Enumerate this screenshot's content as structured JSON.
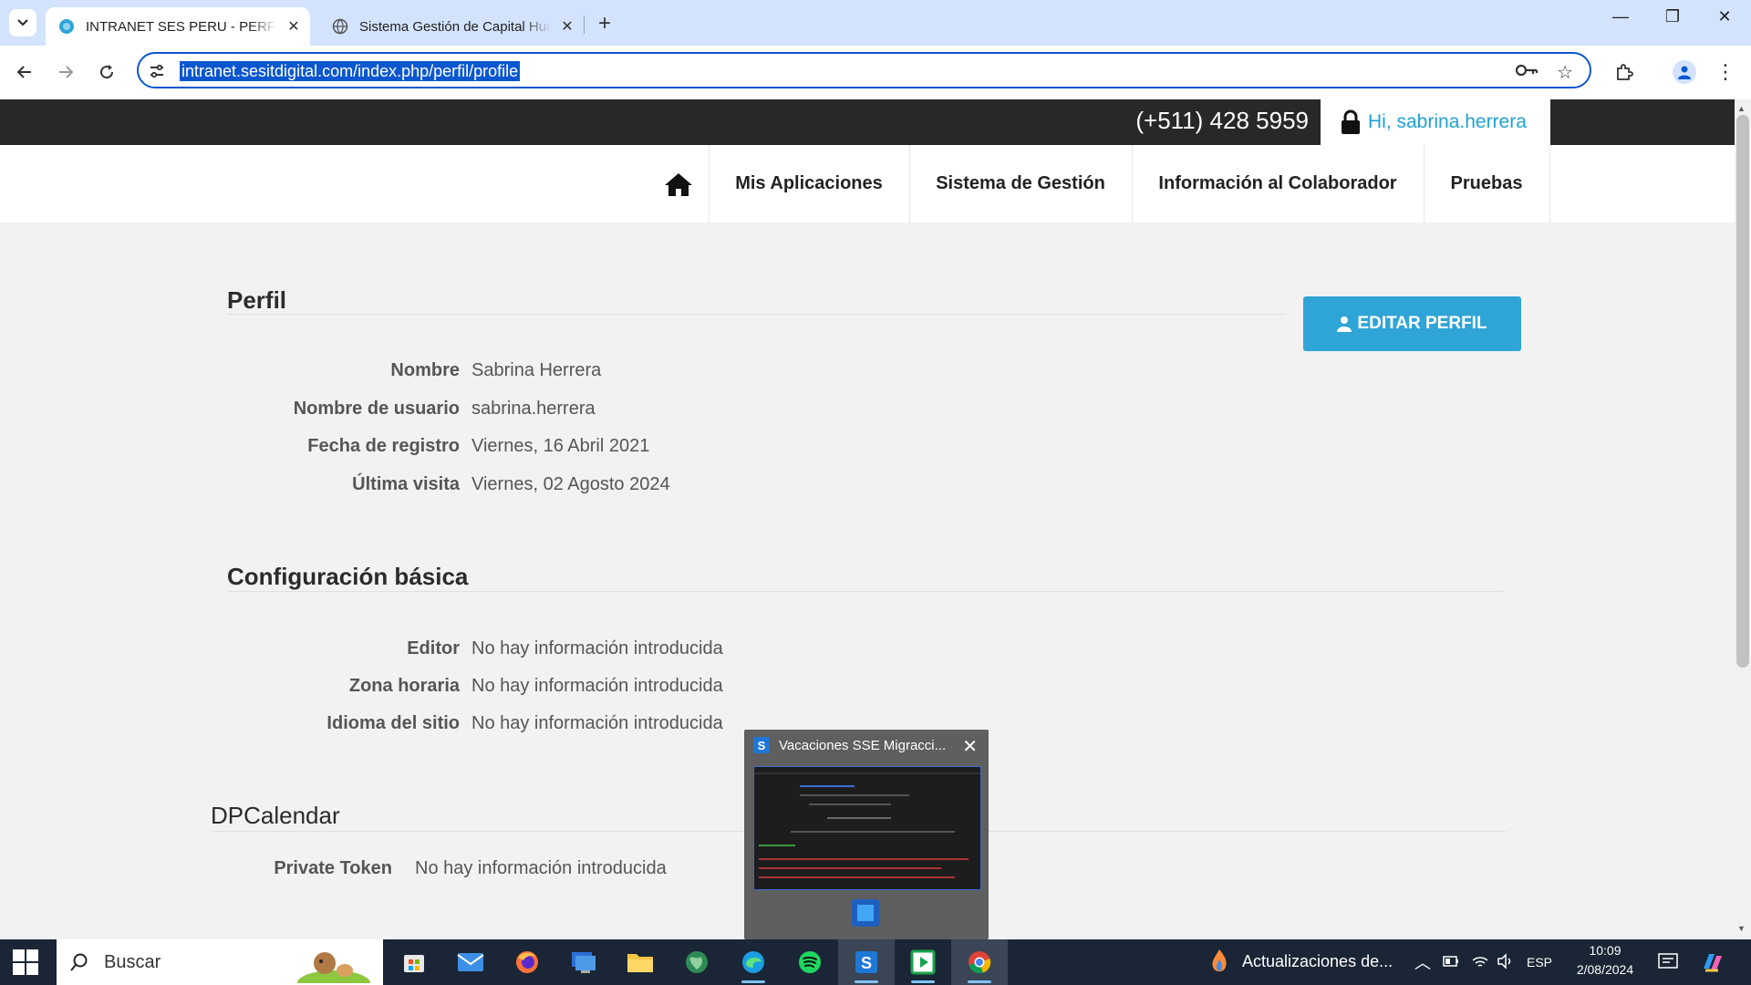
{
  "browser": {
    "tabs": [
      {
        "title": "INTRANET SES PERU - PERFIL D",
        "active": true
      },
      {
        "title": "Sistema Gestión de Capital Hum",
        "active": false
      }
    ],
    "url": "intranet.sesitdigital.com/index.php/perfil/profile",
    "accent": "#0b57d0"
  },
  "site": {
    "phone": "(+511) 428 5959",
    "greeting": "Hi, sabrina.herrera",
    "nav": [
      "Mis Aplicaciones",
      "Sistema de Gestión",
      "Información al Colaborador",
      "Pruebas"
    ],
    "brand_color": "#2fa4d6"
  },
  "profile": {
    "title": "Perfil",
    "edit_button": "EDITAR PERFIL",
    "rows": [
      {
        "label": "Nombre",
        "value": "Sabrina Herrera"
      },
      {
        "label": "Nombre de usuario",
        "value": "sabrina.herrera"
      },
      {
        "label": "Fecha de registro",
        "value": "Viernes, 16 Abril 2021"
      },
      {
        "label": "Última visita",
        "value": "Viernes, 02 Agosto 2024"
      }
    ]
  },
  "config": {
    "title": "Configuración básica",
    "rows": [
      {
        "label": "Editor",
        "value": "No hay información introducida"
      },
      {
        "label": "Zona horaria",
        "value": "No hay información introducida"
      },
      {
        "label": "Idioma del sitio",
        "value": "No hay información introducida"
      }
    ]
  },
  "dpcalendar": {
    "title": "DPCalendar",
    "rows": [
      {
        "label": "Private Token",
        "value": "No hay información introducida"
      }
    ]
  },
  "preview": {
    "title": "Vacaciones SSE Migracci..."
  },
  "taskbar": {
    "search_placeholder": "Buscar",
    "notification": "Actualizaciones de...",
    "language": "ESP",
    "time": "10:09",
    "date": "2/08/2024"
  }
}
